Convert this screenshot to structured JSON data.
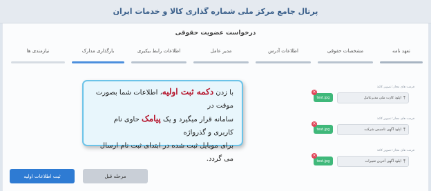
{
  "header": {
    "title": "پرتال جامع مرکز ملی شماره گذاری کالا و خدمات ایران"
  },
  "form": {
    "title": "درخواست عضویت حقوقی"
  },
  "tabs": [
    {
      "label": "تعهد نامه",
      "state": "done"
    },
    {
      "label": "مشخصات حقوقی",
      "state": "done"
    },
    {
      "label": "اطلاعات آدرس",
      "state": "done"
    },
    {
      "label": "مدیر عامل",
      "state": "done"
    },
    {
      "label": "اطلاعات رابط بیکیری",
      "state": "done"
    },
    {
      "label": "بارگذاری مدارک",
      "state": "active"
    },
    {
      "label": "نیازمندی ها",
      "state": "pending"
    }
  ],
  "files": [
    {
      "hint": "فرمت های مجاز: تصویر کاغذ",
      "upload_label": "اپلود کارت ملی مدیرعامل",
      "file_name": "test.jpg"
    },
    {
      "hint": "فرمت های مجاز: تصویر کاغذ",
      "upload_label": "اپلود آگهی تاسیس شرکت",
      "file_name": "test.jpg"
    },
    {
      "hint": "فرمت های مجاز: تصویر کاغذ",
      "upload_label": "اپلود آگهی آخرین تغییرات",
      "file_name": "test.jpg"
    }
  ],
  "overlay": {
    "line1_a": "با زدن ",
    "line1_hl": "دکمه ثبت اولیه",
    "line1_b": "، اطلاعات شما بصورت موقت در",
    "line2_a": "سامانه قرار میگیرد و یک ",
    "line2_hl": "پیامک",
    "line2_b": " حاوی نام کاربری و گذرواژه",
    "line3": "برای موبایل ثبت شده در ابتدای ثبت نام ارسال می گردد."
  },
  "buttons": {
    "submit_label": "ثبت اطلاعات اولیه",
    "prev_label": "مرحله قبل"
  },
  "colors": {
    "accent": "#2e7bd3",
    "success": "#3fb87a",
    "danger": "#e2465b",
    "highlight": "#b5132a"
  }
}
